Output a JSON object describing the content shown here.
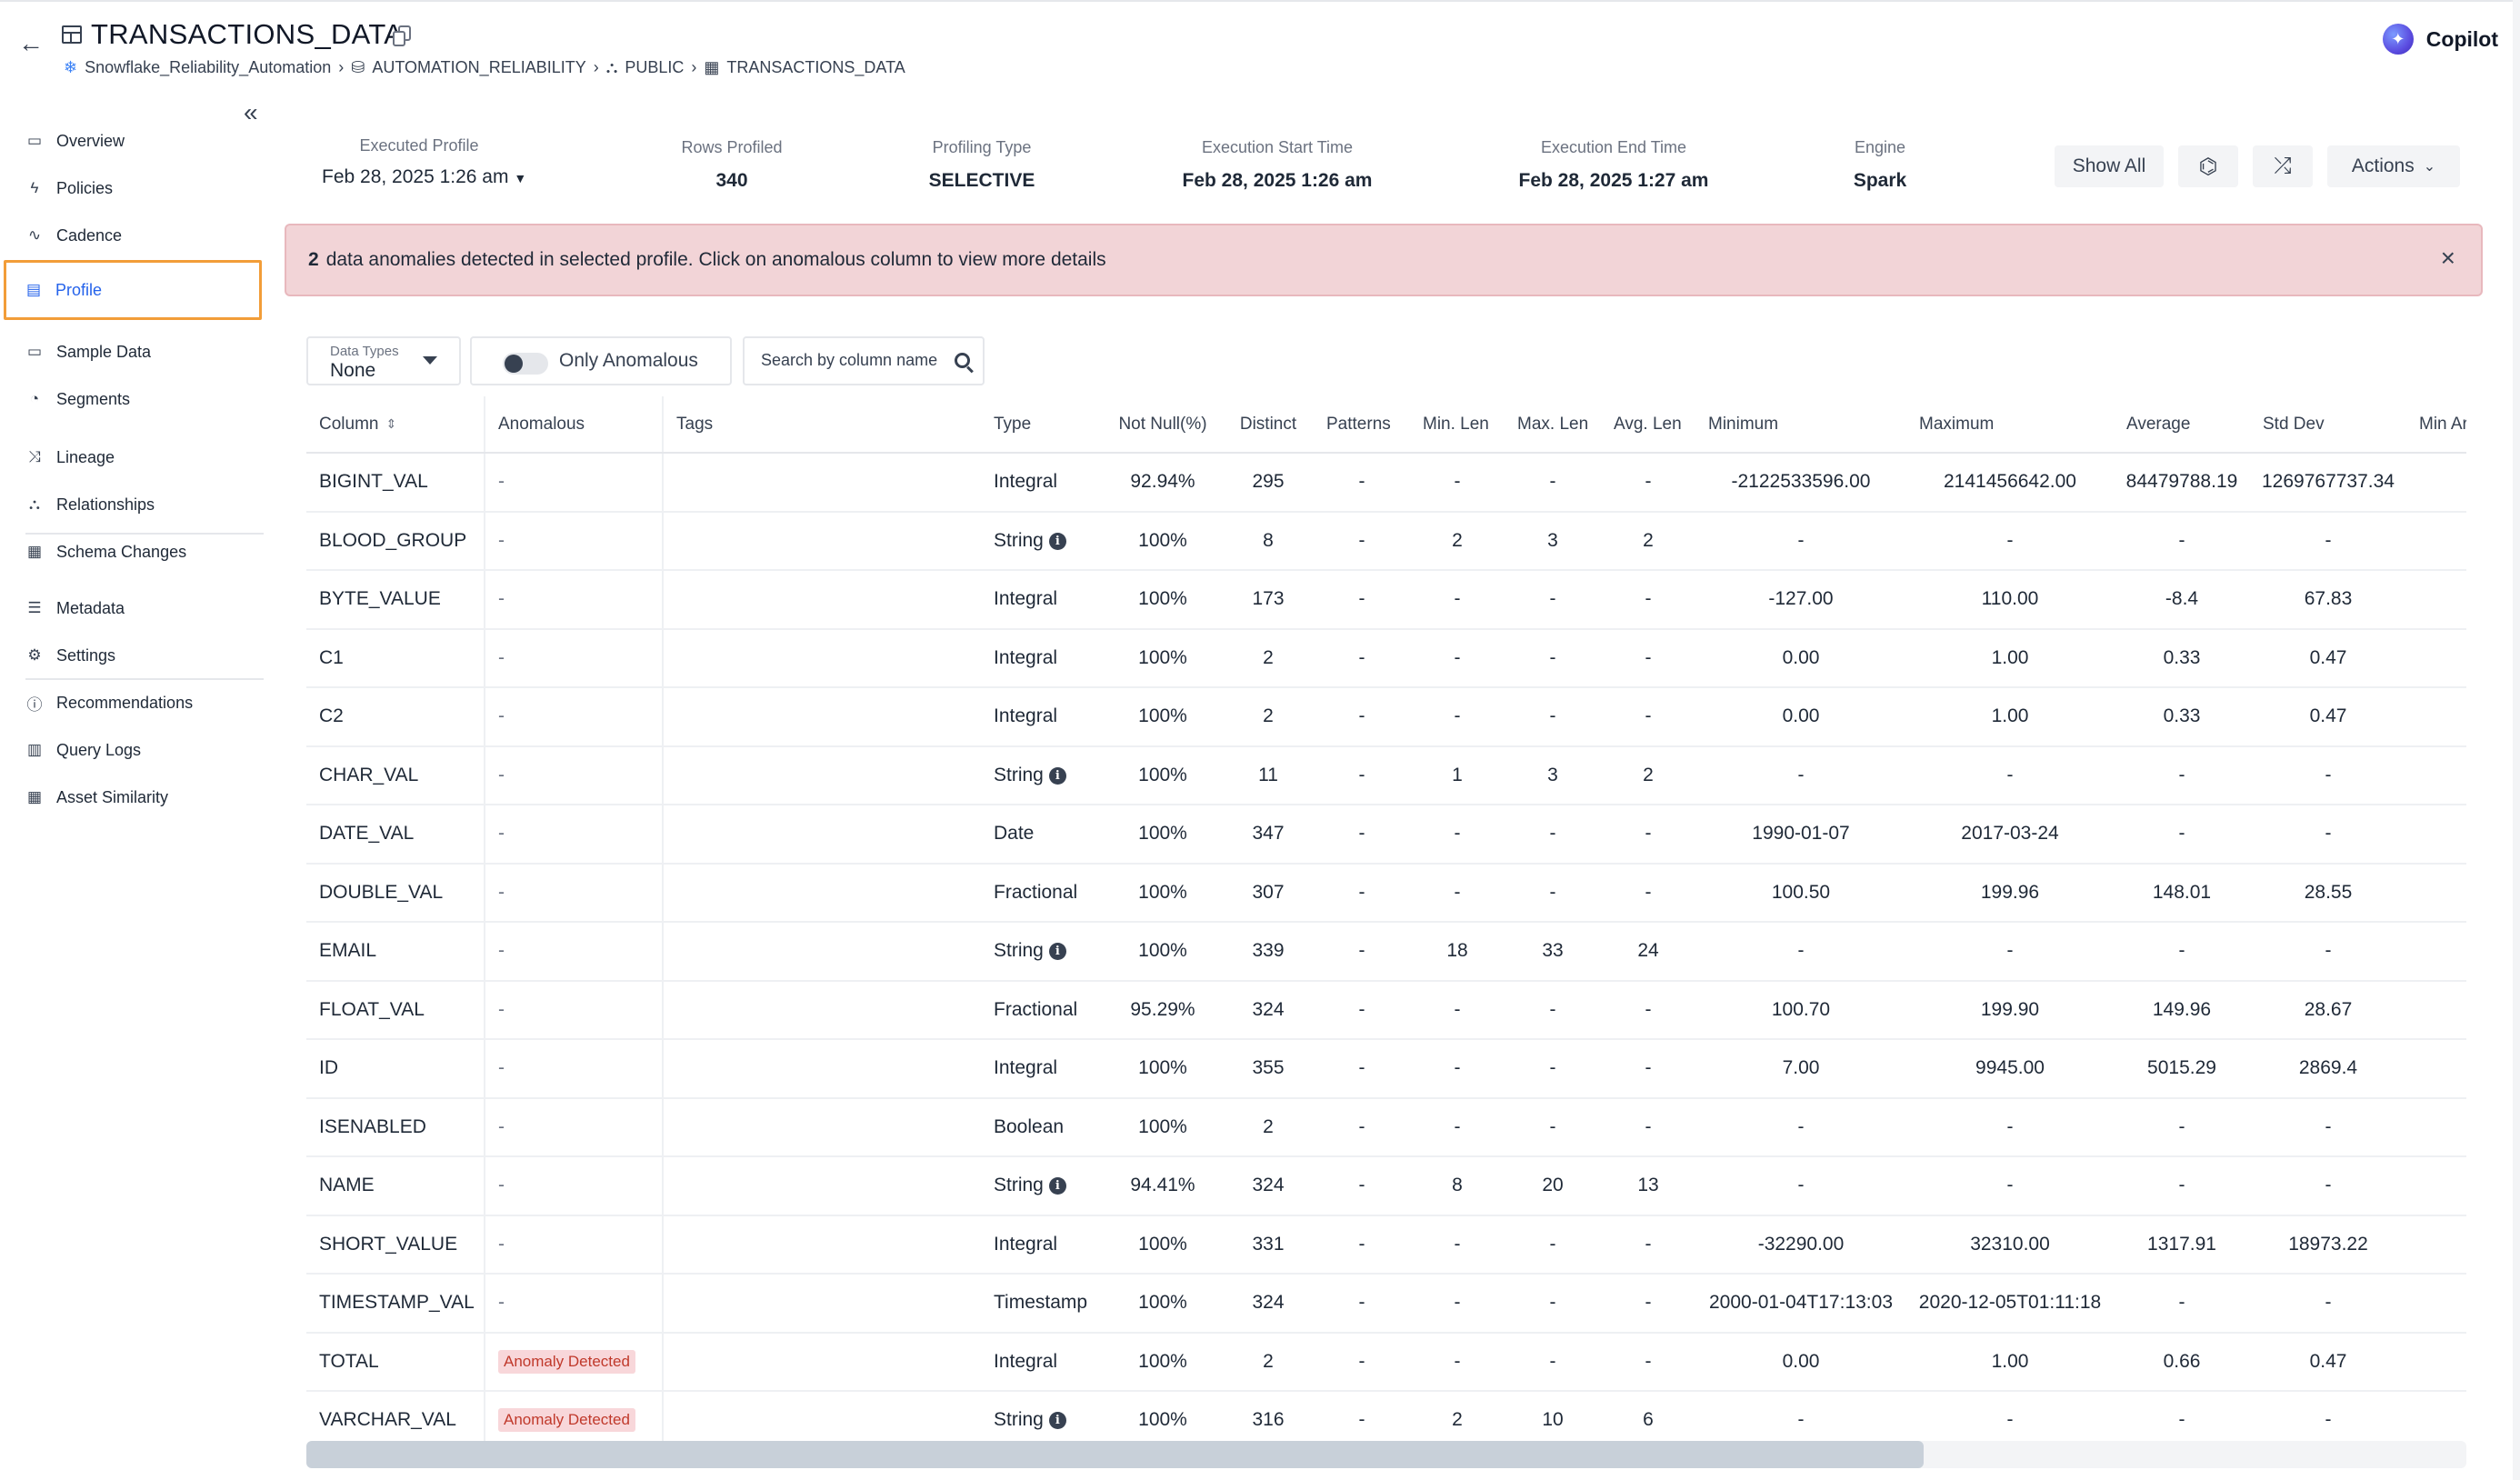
{
  "header": {
    "title": "TRANSACTIONS_DATA",
    "breadcrumbs": [
      "Snowflake_Reliability_Automation",
      "AUTOMATION_RELIABILITY",
      "PUBLIC",
      "TRANSACTIONS_DATA"
    ],
    "copilot": "Copilot"
  },
  "sidebar": {
    "items": [
      {
        "label": "Overview",
        "icon": "overview-icon",
        "glyph": "▭"
      },
      {
        "label": "Policies",
        "icon": "bolt-icon",
        "glyph": "ϟ"
      },
      {
        "label": "Cadence",
        "icon": "pulse-icon",
        "glyph": "∿"
      },
      {
        "label": "Profile",
        "icon": "profile-icon",
        "glyph": "▤",
        "active": true
      },
      {
        "label": "Sample Data",
        "icon": "sample-data-icon",
        "glyph": "▭"
      },
      {
        "label": "Segments",
        "icon": "segments-icon",
        "glyph": "◔"
      },
      {
        "label": "Lineage",
        "icon": "lineage-icon",
        "glyph": "⤨"
      },
      {
        "label": "Relationships",
        "icon": "relationships-icon",
        "glyph": "⛬"
      },
      {
        "label": "Schema Changes",
        "icon": "schema-changes-icon",
        "glyph": "▦"
      },
      {
        "label": "Metadata",
        "icon": "metadata-icon",
        "glyph": "☰"
      },
      {
        "label": "Settings",
        "icon": "settings-icon",
        "glyph": "⚙"
      },
      {
        "label": "Recommendations",
        "icon": "recommendations-icon",
        "glyph": "ⓘ"
      },
      {
        "label": "Query Logs",
        "icon": "query-logs-icon",
        "glyph": "▥"
      },
      {
        "label": "Asset Similarity",
        "icon": "asset-similarity-icon",
        "glyph": "▦"
      }
    ]
  },
  "stats": {
    "executed_profile": {
      "label": "Executed Profile",
      "value": "Feb 28, 2025 1:26 am"
    },
    "rows_profiled": {
      "label": "Rows Profiled",
      "value": "340"
    },
    "profiling_type": {
      "label": "Profiling Type",
      "value": "SELECTIVE"
    },
    "start_time": {
      "label": "Execution Start Time",
      "value": "Feb 28, 2025 1:26 am"
    },
    "end_time": {
      "label": "Execution End Time",
      "value": "Feb 28, 2025 1:27 am"
    },
    "engine": {
      "label": "Engine",
      "value": "Spark"
    }
  },
  "toolbar": {
    "show_all": "Show All",
    "actions": "Actions"
  },
  "banner": {
    "count": "2",
    "message": "data anomalies detected in selected profile. Click on anomalous column to view more details"
  },
  "filters": {
    "data_types_label": "Data Types",
    "data_types_value": "None",
    "only_anomalous": "Only Anomalous",
    "search_placeholder": "Search by column name"
  },
  "table": {
    "headers": [
      "Column",
      "Anomalous",
      "Tags",
      "Type",
      "Not Null(%)",
      "Distinct",
      "Patterns",
      "Min. Len",
      "Max. Len",
      "Avg. Len",
      "Minimum",
      "Maximum",
      "Average",
      "Std Dev",
      "Min Ar"
    ],
    "rows": [
      {
        "column": "BIGINT_VAL",
        "anomalous": "-",
        "type": "Integral",
        "info": false,
        "not_null": "92.94%",
        "distinct": "295",
        "patterns": "-",
        "min_len": "-",
        "max_len": "-",
        "avg_len": "-",
        "minimum": "-2122533596.00",
        "maximum": "2141456642.00",
        "average": "84479788.19",
        "std_dev": "1269767737.34"
      },
      {
        "column": "BLOOD_GROUP",
        "anomalous": "-",
        "type": "String",
        "info": true,
        "not_null": "100%",
        "distinct": "8",
        "patterns": "-",
        "min_len": "2",
        "max_len": "3",
        "avg_len": "2",
        "minimum": "-",
        "maximum": "-",
        "average": "-",
        "std_dev": "-"
      },
      {
        "column": "BYTE_VALUE",
        "anomalous": "-",
        "type": "Integral",
        "info": false,
        "not_null": "100%",
        "distinct": "173",
        "patterns": "-",
        "min_len": "-",
        "max_len": "-",
        "avg_len": "-",
        "minimum": "-127.00",
        "maximum": "110.00",
        "average": "-8.4",
        "std_dev": "67.83"
      },
      {
        "column": "C1",
        "anomalous": "-",
        "type": "Integral",
        "info": false,
        "not_null": "100%",
        "distinct": "2",
        "patterns": "-",
        "min_len": "-",
        "max_len": "-",
        "avg_len": "-",
        "minimum": "0.00",
        "maximum": "1.00",
        "average": "0.33",
        "std_dev": "0.47"
      },
      {
        "column": "C2",
        "anomalous": "-",
        "type": "Integral",
        "info": false,
        "not_null": "100%",
        "distinct": "2",
        "patterns": "-",
        "min_len": "-",
        "max_len": "-",
        "avg_len": "-",
        "minimum": "0.00",
        "maximum": "1.00",
        "average": "0.33",
        "std_dev": "0.47"
      },
      {
        "column": "CHAR_VAL",
        "anomalous": "-",
        "type": "String",
        "info": true,
        "not_null": "100%",
        "distinct": "11",
        "patterns": "-",
        "min_len": "1",
        "max_len": "3",
        "avg_len": "2",
        "minimum": "-",
        "maximum": "-",
        "average": "-",
        "std_dev": "-"
      },
      {
        "column": "DATE_VAL",
        "anomalous": "-",
        "type": "Date",
        "info": false,
        "not_null": "100%",
        "distinct": "347",
        "patterns": "-",
        "min_len": "-",
        "max_len": "-",
        "avg_len": "-",
        "minimum": "1990-01-07",
        "maximum": "2017-03-24",
        "average": "-",
        "std_dev": "-"
      },
      {
        "column": "DOUBLE_VAL",
        "anomalous": "-",
        "type": "Fractional",
        "info": false,
        "not_null": "100%",
        "distinct": "307",
        "patterns": "-",
        "min_len": "-",
        "max_len": "-",
        "avg_len": "-",
        "minimum": "100.50",
        "maximum": "199.96",
        "average": "148.01",
        "std_dev": "28.55"
      },
      {
        "column": "EMAIL",
        "anomalous": "-",
        "type": "String",
        "info": true,
        "not_null": "100%",
        "distinct": "339",
        "patterns": "-",
        "min_len": "18",
        "max_len": "33",
        "avg_len": "24",
        "minimum": "-",
        "maximum": "-",
        "average": "-",
        "std_dev": "-"
      },
      {
        "column": "FLOAT_VAL",
        "anomalous": "-",
        "type": "Fractional",
        "info": false,
        "not_null": "95.29%",
        "distinct": "324",
        "patterns": "-",
        "min_len": "-",
        "max_len": "-",
        "avg_len": "-",
        "minimum": "100.70",
        "maximum": "199.90",
        "average": "149.96",
        "std_dev": "28.67"
      },
      {
        "column": "ID",
        "anomalous": "-",
        "type": "Integral",
        "info": false,
        "not_null": "100%",
        "distinct": "355",
        "patterns": "-",
        "min_len": "-",
        "max_len": "-",
        "avg_len": "-",
        "minimum": "7.00",
        "maximum": "9945.00",
        "average": "5015.29",
        "std_dev": "2869.4"
      },
      {
        "column": "ISENABLED",
        "anomalous": "-",
        "type": "Boolean",
        "info": false,
        "not_null": "100%",
        "distinct": "2",
        "patterns": "-",
        "min_len": "-",
        "max_len": "-",
        "avg_len": "-",
        "minimum": "-",
        "maximum": "-",
        "average": "-",
        "std_dev": "-"
      },
      {
        "column": "NAME",
        "anomalous": "-",
        "type": "String",
        "info": true,
        "not_null": "94.41%",
        "distinct": "324",
        "patterns": "-",
        "min_len": "8",
        "max_len": "20",
        "avg_len": "13",
        "minimum": "-",
        "maximum": "-",
        "average": "-",
        "std_dev": "-"
      },
      {
        "column": "SHORT_VALUE",
        "anomalous": "-",
        "type": "Integral",
        "info": false,
        "not_null": "100%",
        "distinct": "331",
        "patterns": "-",
        "min_len": "-",
        "max_len": "-",
        "avg_len": "-",
        "minimum": "-32290.00",
        "maximum": "32310.00",
        "average": "1317.91",
        "std_dev": "18973.22"
      },
      {
        "column": "TIMESTAMP_VAL",
        "anomalous": "-",
        "type": "Timestamp",
        "info": false,
        "not_null": "100%",
        "distinct": "324",
        "patterns": "-",
        "min_len": "-",
        "max_len": "-",
        "avg_len": "-",
        "minimum": "2000-01-04T17:13:03",
        "maximum": "2020-12-05T01:11:18",
        "average": "-",
        "std_dev": "-"
      },
      {
        "column": "TOTAL",
        "anomalous": "Anomaly Detected",
        "type": "Integral",
        "info": false,
        "not_null": "100%",
        "distinct": "2",
        "patterns": "-",
        "min_len": "-",
        "max_len": "-",
        "avg_len": "-",
        "minimum": "0.00",
        "maximum": "1.00",
        "average": "0.66",
        "std_dev": "0.47"
      },
      {
        "column": "VARCHAR_VAL",
        "anomalous": "Anomaly Detected",
        "type": "String",
        "info": true,
        "not_null": "100%",
        "distinct": "316",
        "patterns": "-",
        "min_len": "2",
        "max_len": "10",
        "avg_len": "6",
        "minimum": "-",
        "maximum": "-",
        "average": "-",
        "std_dev": "-"
      }
    ]
  },
  "colors": {
    "accent": "#2563eb",
    "active_border": "#f29d38",
    "banner_bg": "#f2d4d7",
    "badge_bg": "#f8d7da",
    "badge_text": "#c0392b"
  }
}
